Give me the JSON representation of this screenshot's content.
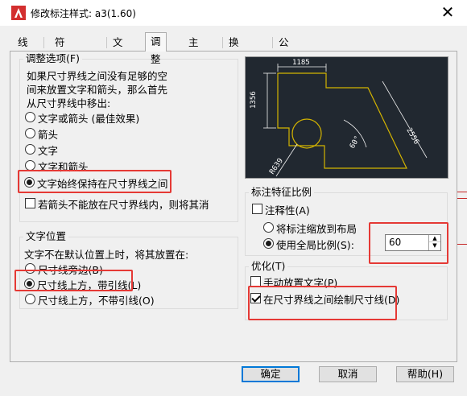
{
  "window": {
    "title": "修改标注样式: a3(1.60)",
    "close_glyph": "✕"
  },
  "tabs": [
    "线",
    "符号和箭头",
    "文字",
    "调整",
    "主单位",
    "换算单位",
    "公差"
  ],
  "active_tab_index": 3,
  "fit_options": {
    "legend": "调整选项(F)",
    "description": [
      "如果尺寸界线之间没有足够的空",
      "间来放置文字和箭头，那么首先",
      "从尺寸界线中移出:"
    ],
    "options": [
      "文字或箭头 (最佳效果)",
      "箭头",
      "文字",
      "文字和箭头",
      "文字始终保持在尺寸界线之间"
    ],
    "selected_index": 4,
    "suppress_arrows_label": "若箭头不能放在尺寸界线内，则将其消",
    "suppress_arrows_checked": false
  },
  "text_placement": {
    "legend": "文字位置",
    "description": "文字不在默认位置上时，将其放置在:",
    "options": [
      "尺寸线旁边(B)",
      "尺寸线上方，带引线(L)",
      "尺寸线上方，不带引线(O)"
    ],
    "selected_index": 1
  },
  "preview": {
    "labels": [
      "1185",
      "1356",
      "2556",
      "60°",
      "R639"
    ],
    "line_color": "#d4b400",
    "background": "#212830"
  },
  "scale": {
    "legend": "标注特征比例",
    "annotative_label": "注释性(A)",
    "annotative_checked": false,
    "layout_label": "将标注缩放到布局",
    "global_label": "使用全局比例(S):",
    "selected": "global",
    "global_value": "60"
  },
  "finetune": {
    "legend": "优化(T)",
    "manual_label": "手动放置文字(P)",
    "manual_checked": false,
    "draw_line_label": "在尺寸界线之间绘制尺寸线(D)",
    "draw_line_checked": true
  },
  "buttons": {
    "ok": "确定",
    "cancel": "取消",
    "help": "帮助(H)"
  },
  "colors": {
    "highlight": "#e53935",
    "preview_line": "#d4b400",
    "default_button_border": "#0078d7"
  }
}
